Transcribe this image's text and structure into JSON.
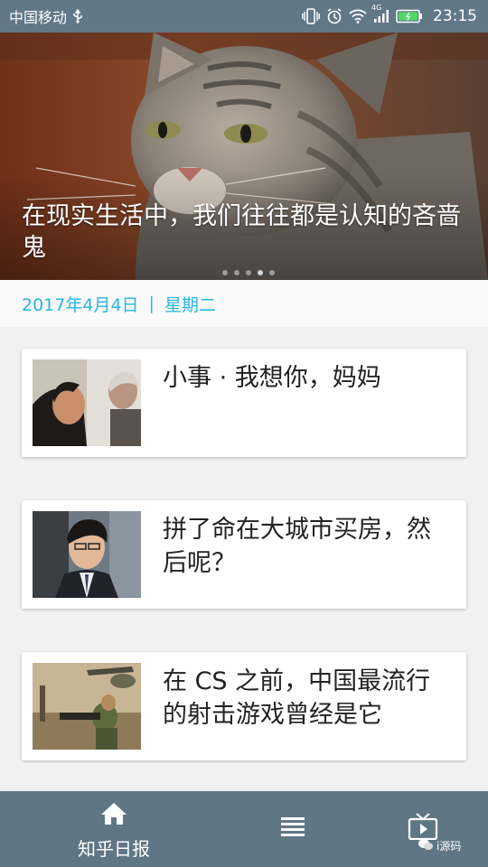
{
  "status_bar": {
    "carrier": "中国移动",
    "network_badge": "4G",
    "time": "23:15",
    "icons": [
      "usb-icon",
      "vibrate-icon",
      "alarm-icon",
      "wifi-icon",
      "signal-icon",
      "battery-icon"
    ]
  },
  "hero": {
    "title": "在现实生活中，我们往往都是认知的吝啬鬼",
    "page_count": 5,
    "active_page": 4
  },
  "date_row": {
    "date": "2017年4月4日",
    "separator": "|",
    "weekday": "星期二"
  },
  "stories": [
    {
      "title": "小事 · 我想你，妈妈"
    },
    {
      "title": "拼了命在大城市买房，然后呢？"
    },
    {
      "title": "在 CS 之前，中国最流行的射击游戏曾经是它"
    }
  ],
  "bottom_nav": {
    "home_label": "知乎日报",
    "icons": [
      "home-icon",
      "list-icon",
      "tv-icon"
    ]
  },
  "watermark": "i源码",
  "colors": {
    "status_bar": "#617887",
    "bottom_nav": "#5f7684",
    "date_accent": "#27b5e0",
    "page_bg": "#f1f1f1"
  }
}
